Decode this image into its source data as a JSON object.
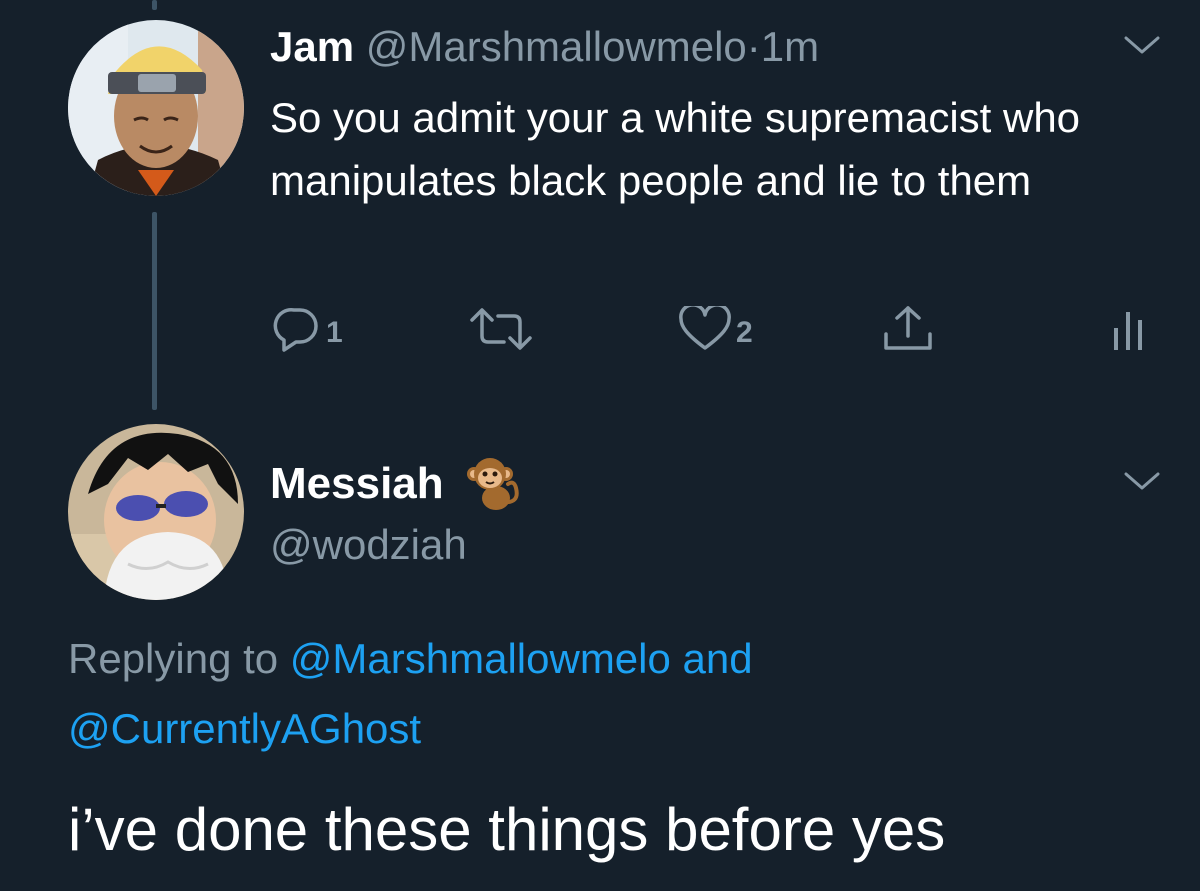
{
  "colors": {
    "background": "#15202b",
    "primary_text": "#ffffff",
    "secondary_text": "#8899a6",
    "link": "#1da1f2",
    "thread_line": "#3d5466"
  },
  "tweet1": {
    "display_name": "Jam",
    "handle": "@Marshmallowmelo",
    "separator": "·",
    "time": "1m",
    "text": "So you admit your a white supremacist who manipulates black people and lie to them",
    "avatar_icon": "anime-character-avatar",
    "actions": {
      "reply_icon": "reply-icon",
      "reply_count": "1",
      "retweet_icon": "retweet-icon",
      "like_icon": "heart-icon",
      "like_count": "2",
      "share_icon": "share-icon",
      "analytics_icon": "analytics-icon"
    },
    "menu_icon": "chevron-down-icon"
  },
  "tweet2": {
    "display_name": "Messiah",
    "name_emoji": "🐒",
    "handle": "@wodziah",
    "avatar_icon": "anime-character-avatar",
    "menu_icon": "chevron-down-icon",
    "replying_prefix": "Replying to",
    "replying_user1": "@Marshmallowmelo",
    "replying_and": "and",
    "replying_user2": "@CurrentlyAGhost",
    "text": "i’ve done these things before yes"
  }
}
